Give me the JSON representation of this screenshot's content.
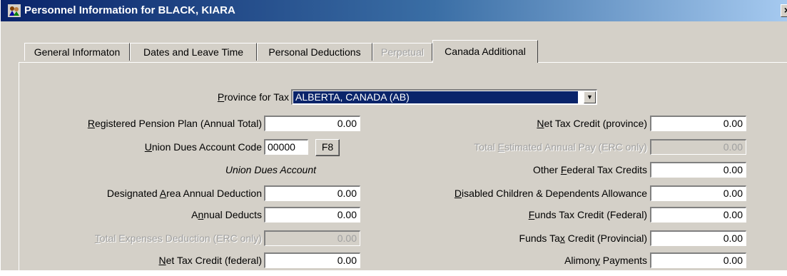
{
  "window": {
    "title": "Personnel Information for BLACK, KIARA",
    "close_label": "×"
  },
  "tabs": [
    {
      "label": "General Informaton",
      "state": "normal"
    },
    {
      "label": "Dates and Leave Time",
      "state": "normal"
    },
    {
      "label": "Personal Deductions",
      "state": "normal"
    },
    {
      "label": "Perpetual",
      "state": "disabled"
    },
    {
      "label": "Canada Additional",
      "state": "active"
    }
  ],
  "province": {
    "label_prefix": "",
    "label_accel": "P",
    "label_rest": "rovince for Tax",
    "value": "ALBERTA, CANADA (AB)"
  },
  "left_fields": {
    "pension": {
      "accel": "R",
      "rest": "egistered Pension Plan (Annual Total)",
      "value": "0.00"
    },
    "union_code": {
      "accel": "U",
      "rest": "nion Dues Account Code",
      "value": "00000",
      "button": "F8"
    },
    "union_account_label": "Union Dues Account",
    "designated": {
      "pre": "Designated ",
      "accel": "A",
      "rest": "rea Annual Deduction",
      "value": "0.00"
    },
    "annual": {
      "pre": "A",
      "accel": "n",
      "rest": "nual Deducts",
      "value": "0.00"
    },
    "expenses": {
      "accel": "T",
      "rest": "otal Expenses Deduction (ERC only)",
      "value": "0.00"
    },
    "net_federal": {
      "accel": "N",
      "rest": "et Tax Credit (federal)",
      "value": "0.00"
    }
  },
  "right_fields": {
    "net_province": {
      "accel": "N",
      "rest": "et Tax Credit (province)",
      "value": "0.00"
    },
    "estimated": {
      "pre": "Total ",
      "accel": "E",
      "rest": "stimated Annual Pay (ERC only)",
      "value": "0.00"
    },
    "other_federal": {
      "pre": "Other ",
      "accel": "F",
      "rest": "ederal Tax Credits",
      "value": "0.00"
    },
    "disabled": {
      "accel": "D",
      "rest": "isabled Children & Dependents Allowance",
      "value": "0.00"
    },
    "funds_federal": {
      "accel": "F",
      "rest": "unds Tax Credit (Federal)",
      "value": "0.00"
    },
    "funds_provincial": {
      "pre": "Funds Ta",
      "accel": "x",
      "rest": " Credit (Provincial)",
      "value": "0.00"
    },
    "alimony": {
      "pre": "Alimon",
      "accel": "y",
      "rest": " Payments",
      "value": "0.00"
    }
  }
}
